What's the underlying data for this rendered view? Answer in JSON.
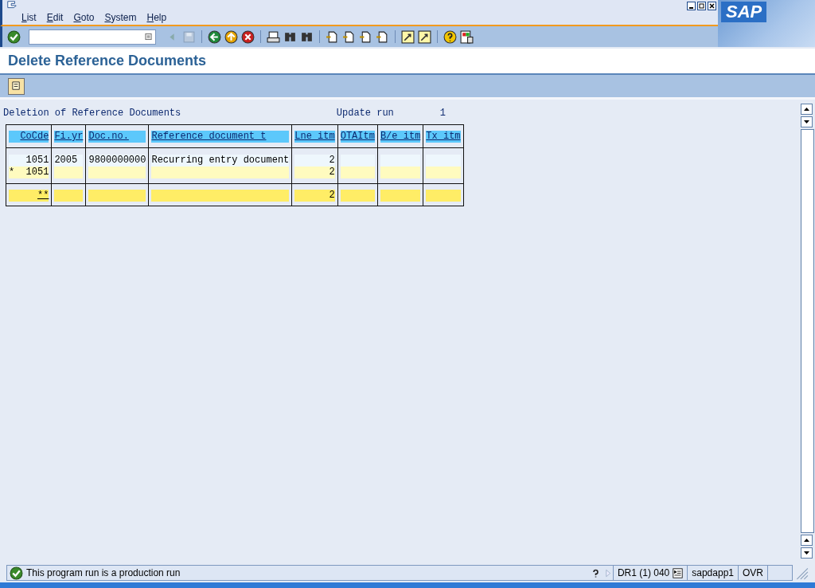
{
  "menu": [
    {
      "label": "List"
    },
    {
      "label": "Edit"
    },
    {
      "label": "Goto"
    },
    {
      "label": "System"
    },
    {
      "label": "Help"
    }
  ],
  "logo": "SAP",
  "title": "Delete Reference Documents",
  "list_header": {
    "heading": "Deletion of Reference Documents",
    "label": "Update run",
    "value": "1"
  },
  "table": {
    "columns": [
      {
        "label": "CoCde"
      },
      {
        "label": "Fi.yr"
      },
      {
        "label": "Doc.no."
      },
      {
        "label": "Reference document t"
      },
      {
        "label": "Lne itm"
      },
      {
        "label": "OTAItm"
      },
      {
        "label": "B/e itm"
      },
      {
        "label": "Tx itm"
      }
    ],
    "blocks": [
      {
        "rows": [
          {
            "kind": "item",
            "cells": [
              "1051",
              "2005",
              "9800000000",
              "Recurring entry document",
              "2",
              null,
              null,
              null
            ]
          },
          {
            "kind": "subtotal",
            "cells": [
              "*  1051",
              null,
              null,
              null,
              "2",
              null,
              null,
              null
            ]
          }
        ]
      },
      {
        "rows": [
          {
            "kind": "total",
            "cells": [
              "**",
              null,
              null,
              null,
              "2",
              null,
              null,
              null
            ]
          }
        ]
      }
    ]
  },
  "status_bar": {
    "message": {
      "kind": "success",
      "text": "This program run is a production run"
    },
    "system": "DR1 (1) 040",
    "server": "sapdapp1",
    "mode": "OVR"
  }
}
